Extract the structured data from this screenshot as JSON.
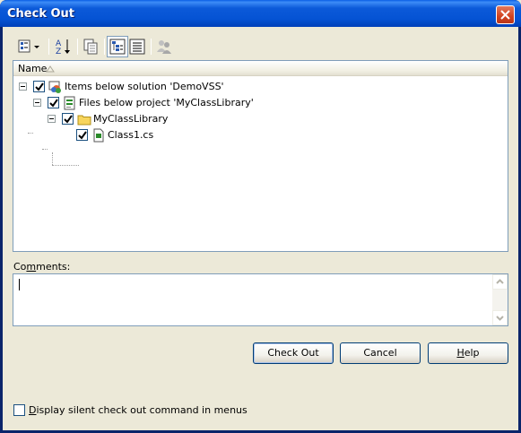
{
  "window": {
    "title": "Check Out"
  },
  "toolbar": {
    "buttons": [
      {
        "name": "view-options-dropdown",
        "icon": "view-options-icon"
      },
      {
        "name": "sort-button",
        "icon": "sort-az-icon"
      },
      {
        "name": "copy-button",
        "icon": "copy-icon"
      },
      {
        "name": "tree-view-button",
        "icon": "tree-view-icon",
        "active": true
      },
      {
        "name": "list-view-button",
        "icon": "list-view-icon"
      },
      {
        "name": "people-button",
        "icon": "people-icon",
        "disabled": true
      }
    ]
  },
  "list": {
    "column_header": "Name",
    "items": [
      {
        "label": "Items below solution 'DemoVSS'",
        "icon": "solution-icon",
        "checked": true,
        "expanded": true
      },
      {
        "label": "Files below project 'MyClassLibrary'",
        "icon": "project-icon",
        "checked": true,
        "expanded": true
      },
      {
        "label": "MyClassLibrary",
        "icon": "folder-icon",
        "checked": true,
        "expanded": true
      },
      {
        "label": "Class1.cs",
        "icon": "cs-file-icon",
        "checked": true
      }
    ]
  },
  "comments": {
    "label_pre": "Co",
    "label_mnemonic": "m",
    "label_post": "ments:",
    "value": ""
  },
  "buttons": {
    "checkout": "Check Out",
    "cancel": "Cancel",
    "help_mnemonic": "H",
    "help_rest": "elp"
  },
  "silent": {
    "mnemonic": "D",
    "rest": "isplay silent check out command in menus",
    "checked": false
  },
  "colors": {
    "titlebar": "#0553d4",
    "client": "#ece9d8",
    "border": "#7f9db9",
    "folder": "#f7d55d"
  }
}
